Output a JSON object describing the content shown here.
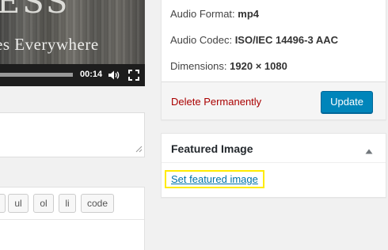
{
  "video": {
    "title_fragment": "ESS",
    "subtitle_fragment": "es Everywhere",
    "time": "00:14",
    "progress": 1.0,
    "icons": [
      "volume-icon",
      "fullscreen-icon"
    ]
  },
  "editor": {
    "quicktags": [
      "ul",
      "ol",
      "li",
      "code"
    ]
  },
  "attachment": {
    "audio_format_label": "Audio Format:",
    "audio_format_value": "mp4",
    "audio_codec_label": "Audio Codec:",
    "audio_codec_value": "ISO/IEC 14496-3 AAC",
    "dimensions_label": "Dimensions:",
    "dimensions_value": "1920 × 1080",
    "delete_label": "Delete Permanently",
    "update_label": "Update"
  },
  "featured_image": {
    "title": "Featured Image",
    "set_link": "Set featured image",
    "toggle_icon": "triangle-up-icon"
  },
  "colors": {
    "update_button": "#0085ba",
    "delete_link": "#a00000",
    "link": "#0073aa",
    "highlight": "#ffeb00"
  }
}
